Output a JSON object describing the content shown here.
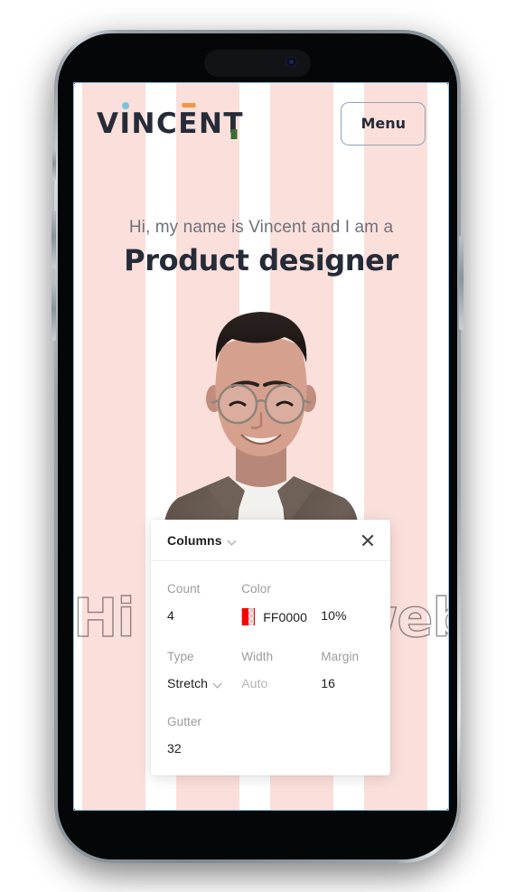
{
  "site": {
    "logo": {
      "text": "VINCENT",
      "letters": [
        "V",
        "I",
        "N",
        "C",
        "E",
        "N",
        "T"
      ],
      "accent_dot_color": "#7CC2E0",
      "accent_bar_color": "#F2964A",
      "accent_square_color": "#3F6B35",
      "text_color": "#262B38"
    },
    "menu_button_label": "Menu",
    "hero": {
      "kicker": "Hi, my name is Vincent and I am a",
      "title": "Product designer",
      "ghost_word": "Hi I am a web designer"
    },
    "background": {
      "stripe_color": "#FBDFDB",
      "base_color": "#FFFFFF",
      "stripe_count": 4
    }
  },
  "panel": {
    "title": "Columns",
    "title_chevron_icon": "chevron-down-icon",
    "close_icon": "close-icon",
    "fields": {
      "count": {
        "label": "Count",
        "value": "4"
      },
      "color": {
        "label": "Color",
        "hex": "FF0000",
        "opacity": "10%",
        "swatch_color": "#FF0000"
      },
      "type": {
        "label": "Type",
        "value": "Stretch",
        "chevron_icon": "chevron-down-icon"
      },
      "width": {
        "label": "Width",
        "value": "Auto",
        "is_placeholder": true
      },
      "margin": {
        "label": "Margin",
        "value": "16"
      },
      "gutter": {
        "label": "Gutter",
        "value": "32"
      }
    }
  },
  "device": {
    "selection_outline_color": "#8EC8EF",
    "frame_color": "#7F878F",
    "bezel_color": "#050608"
  }
}
